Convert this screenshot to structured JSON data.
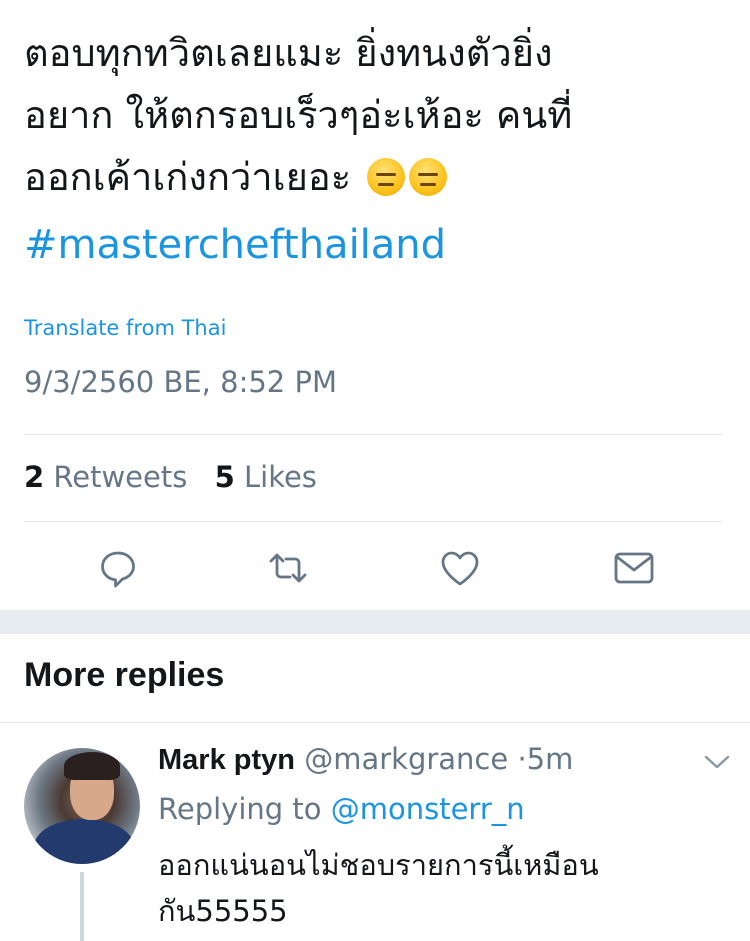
{
  "tweet": {
    "text_lines": [
      "ตอบทุกทวิตเลยแมะ ยิ่งทนงตัวยิ่ง",
      "อยาก ให้ตกรอบเร็วๆอ่ะเห้อะ คนที่",
      "ออกเค้าเก่งกว่าเยอะ"
    ],
    "emoji_names": [
      "expressionless-face-emoji",
      "expressionless-face-emoji"
    ],
    "hashtag": "#masterchefthailand",
    "translate_label": "Translate from Thai",
    "timestamp": "9/3/2560 BE, 8:52 PM",
    "retweets_count": "2",
    "retweets_label": "Retweets",
    "likes_count": "5",
    "likes_label": "Likes"
  },
  "actions": [
    {
      "name": "reply-icon"
    },
    {
      "name": "retweet-icon"
    },
    {
      "name": "like-icon"
    },
    {
      "name": "direct-message-icon"
    }
  ],
  "more_replies": {
    "title": "More replies",
    "reply": {
      "display_name": "Mark ptyn",
      "handle": "@markgrance",
      "separator": "·",
      "time": "5m",
      "replying_to_label": "Replying to",
      "replying_to_handle": "@monsterr_n",
      "text_lines": [
        "ออกแน่นอนไม่ชอบรายการนี้เหมือน",
        "กัน55555"
      ]
    }
  },
  "colors": {
    "link": "#1b95e0",
    "secondary_text": "#657786",
    "primary_text": "#14171a",
    "divider": "#e1e8ed",
    "band": "#e6ecf0"
  }
}
